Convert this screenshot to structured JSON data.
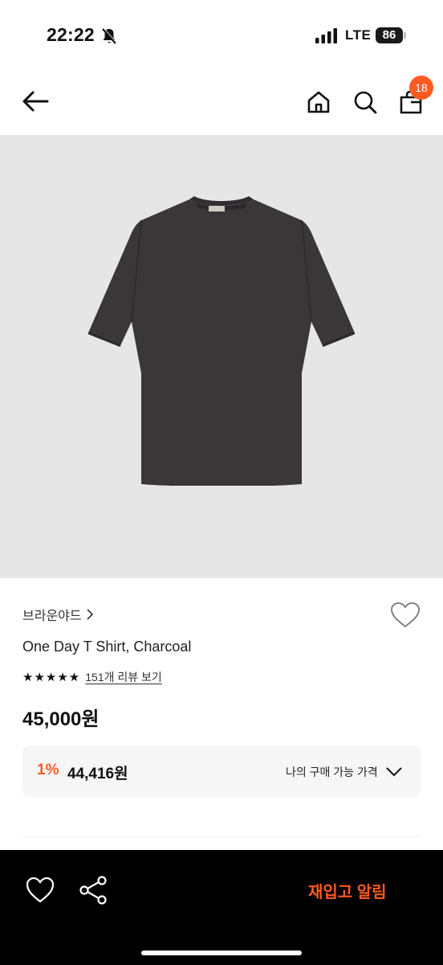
{
  "status_bar": {
    "time": "22:22",
    "network": "LTE",
    "battery": "86"
  },
  "header": {
    "cart_count": "18"
  },
  "product": {
    "brand": "브라운야드",
    "name": "One Day T Shirt, Charcoal",
    "rating_stars": "★★★★★",
    "review_text": "151개 리뷰 보기",
    "price": "45,000원",
    "discount": "1%",
    "my_price": "44,416원",
    "my_price_label": "나의 구매 가능 가격",
    "image_color": "#3a3739"
  },
  "bottom_bar": {
    "restock_label": "재입고 알림"
  },
  "colors": {
    "accent": "#ff5a1f"
  }
}
